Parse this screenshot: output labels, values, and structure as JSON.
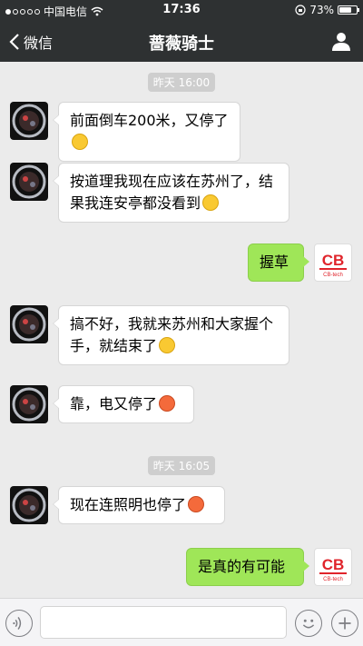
{
  "status": {
    "carrier": "中国电信",
    "time": "17:36",
    "battery": "73%",
    "battery_level": 0.73
  },
  "nav": {
    "back_label": "微信",
    "title": "蔷薇骑士"
  },
  "timestamps": [
    "昨天 16:00",
    "昨天 16:05"
  ],
  "messages": [
    {
      "from": "contact",
      "text": "前面倒车200米，又停了",
      "emoji": "yellow"
    },
    {
      "from": "contact",
      "text": "按道理我现在应该在苏州了，结果我连安亭都没看到",
      "emoji": "yellow"
    },
    {
      "from": "me",
      "text": "握草"
    },
    {
      "from": "contact",
      "text": "搞不好，我就来苏州和大家握个手，就结束了",
      "emoji": "yellow"
    },
    {
      "from": "contact",
      "text": "靠，电又停了",
      "emoji": "red"
    },
    {
      "from": "contact",
      "text": "现在连照明也停了",
      "emoji": "red"
    },
    {
      "from": "me",
      "text": "是真的有可能"
    }
  ],
  "my_avatar": {
    "logo": "CB",
    "caption": "CB-tech",
    "brand_color": "#e0242b"
  },
  "input": {
    "placeholder": ""
  },
  "colors": {
    "bar": "#2e3132",
    "background": "#ebebeb",
    "my_bubble": "#9fe658"
  }
}
